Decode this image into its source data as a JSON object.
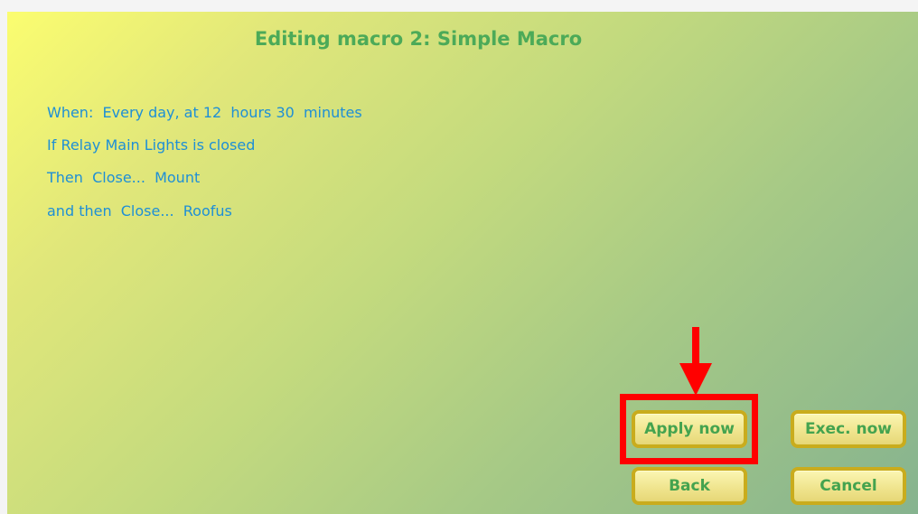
{
  "title": "Editing macro 2: Simple Macro",
  "macro": {
    "when_label": "When:",
    "when_value": "Every day, at 12  hours 30  minutes",
    "if_line": "If Relay Main Lights is closed",
    "then_line": "Then  Close...  Mount",
    "and_then_line": "and then  Close...  Roofus"
  },
  "buttons": {
    "apply_now": "Apply now",
    "exec_now": "Exec. now",
    "back": "Back",
    "cancel": "Cancel"
  },
  "annotation": {
    "highlight_color": "#ff0000",
    "target": "Apply now"
  },
  "colors": {
    "title": "#4caa58",
    "body_text": "#1e8fd6",
    "button_border": "#c9ac1d",
    "button_text": "#44a34f"
  }
}
